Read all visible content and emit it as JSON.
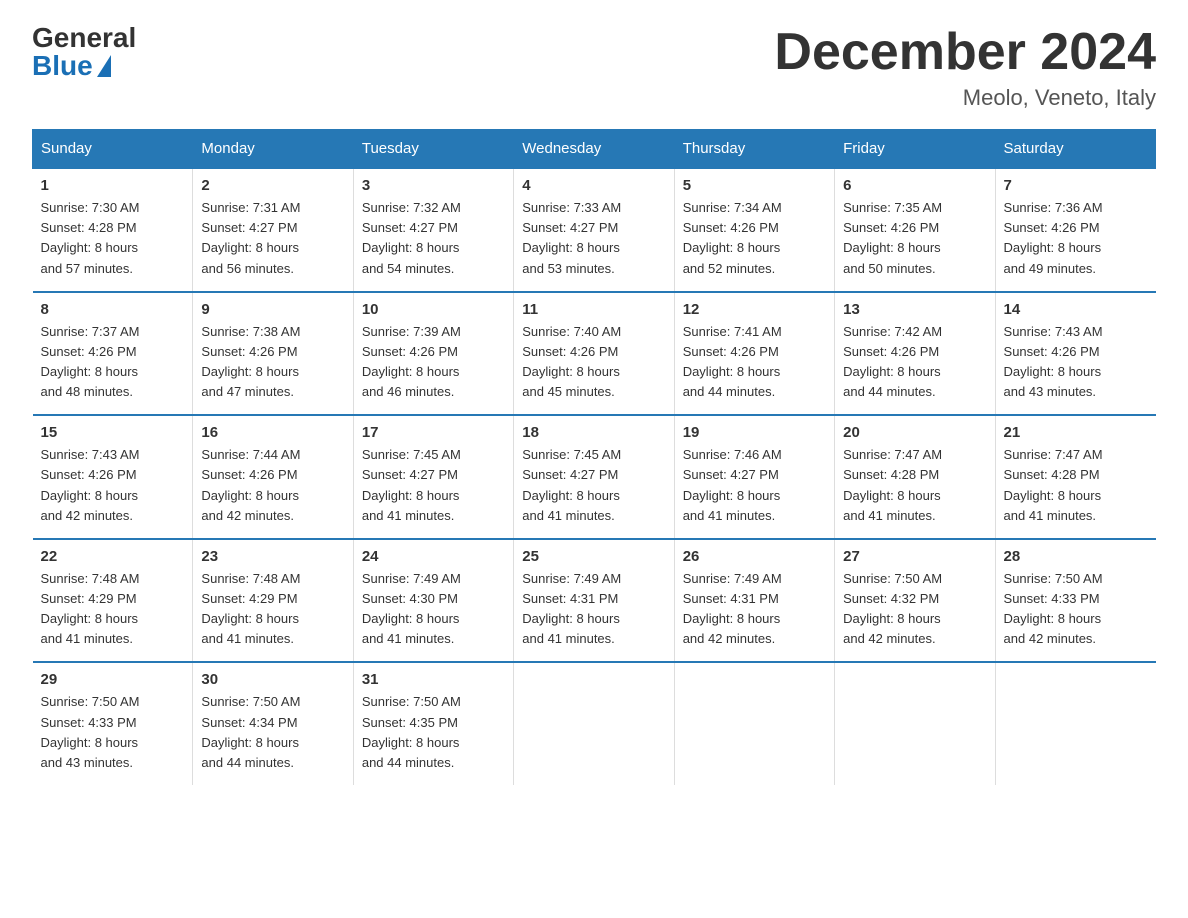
{
  "header": {
    "logo_general": "General",
    "logo_blue": "Blue",
    "month_title": "December 2024",
    "location": "Meolo, Veneto, Italy"
  },
  "weekdays": [
    "Sunday",
    "Monday",
    "Tuesday",
    "Wednesday",
    "Thursday",
    "Friday",
    "Saturday"
  ],
  "weeks": [
    [
      {
        "day": "1",
        "sunrise": "7:30 AM",
        "sunset": "4:28 PM",
        "daylight": "8 hours and 57 minutes."
      },
      {
        "day": "2",
        "sunrise": "7:31 AM",
        "sunset": "4:27 PM",
        "daylight": "8 hours and 56 minutes."
      },
      {
        "day": "3",
        "sunrise": "7:32 AM",
        "sunset": "4:27 PM",
        "daylight": "8 hours and 54 minutes."
      },
      {
        "day": "4",
        "sunrise": "7:33 AM",
        "sunset": "4:27 PM",
        "daylight": "8 hours and 53 minutes."
      },
      {
        "day": "5",
        "sunrise": "7:34 AM",
        "sunset": "4:26 PM",
        "daylight": "8 hours and 52 minutes."
      },
      {
        "day": "6",
        "sunrise": "7:35 AM",
        "sunset": "4:26 PM",
        "daylight": "8 hours and 50 minutes."
      },
      {
        "day": "7",
        "sunrise": "7:36 AM",
        "sunset": "4:26 PM",
        "daylight": "8 hours and 49 minutes."
      }
    ],
    [
      {
        "day": "8",
        "sunrise": "7:37 AM",
        "sunset": "4:26 PM",
        "daylight": "8 hours and 48 minutes."
      },
      {
        "day": "9",
        "sunrise": "7:38 AM",
        "sunset": "4:26 PM",
        "daylight": "8 hours and 47 minutes."
      },
      {
        "day": "10",
        "sunrise": "7:39 AM",
        "sunset": "4:26 PM",
        "daylight": "8 hours and 46 minutes."
      },
      {
        "day": "11",
        "sunrise": "7:40 AM",
        "sunset": "4:26 PM",
        "daylight": "8 hours and 45 minutes."
      },
      {
        "day": "12",
        "sunrise": "7:41 AM",
        "sunset": "4:26 PM",
        "daylight": "8 hours and 44 minutes."
      },
      {
        "day": "13",
        "sunrise": "7:42 AM",
        "sunset": "4:26 PM",
        "daylight": "8 hours and 44 minutes."
      },
      {
        "day": "14",
        "sunrise": "7:43 AM",
        "sunset": "4:26 PM",
        "daylight": "8 hours and 43 minutes."
      }
    ],
    [
      {
        "day": "15",
        "sunrise": "7:43 AM",
        "sunset": "4:26 PM",
        "daylight": "8 hours and 42 minutes."
      },
      {
        "day": "16",
        "sunrise": "7:44 AM",
        "sunset": "4:26 PM",
        "daylight": "8 hours and 42 minutes."
      },
      {
        "day": "17",
        "sunrise": "7:45 AM",
        "sunset": "4:27 PM",
        "daylight": "8 hours and 41 minutes."
      },
      {
        "day": "18",
        "sunrise": "7:45 AM",
        "sunset": "4:27 PM",
        "daylight": "8 hours and 41 minutes."
      },
      {
        "day": "19",
        "sunrise": "7:46 AM",
        "sunset": "4:27 PM",
        "daylight": "8 hours and 41 minutes."
      },
      {
        "day": "20",
        "sunrise": "7:47 AM",
        "sunset": "4:28 PM",
        "daylight": "8 hours and 41 minutes."
      },
      {
        "day": "21",
        "sunrise": "7:47 AM",
        "sunset": "4:28 PM",
        "daylight": "8 hours and 41 minutes."
      }
    ],
    [
      {
        "day": "22",
        "sunrise": "7:48 AM",
        "sunset": "4:29 PM",
        "daylight": "8 hours and 41 minutes."
      },
      {
        "day": "23",
        "sunrise": "7:48 AM",
        "sunset": "4:29 PM",
        "daylight": "8 hours and 41 minutes."
      },
      {
        "day": "24",
        "sunrise": "7:49 AM",
        "sunset": "4:30 PM",
        "daylight": "8 hours and 41 minutes."
      },
      {
        "day": "25",
        "sunrise": "7:49 AM",
        "sunset": "4:31 PM",
        "daylight": "8 hours and 41 minutes."
      },
      {
        "day": "26",
        "sunrise": "7:49 AM",
        "sunset": "4:31 PM",
        "daylight": "8 hours and 42 minutes."
      },
      {
        "day": "27",
        "sunrise": "7:50 AM",
        "sunset": "4:32 PM",
        "daylight": "8 hours and 42 minutes."
      },
      {
        "day": "28",
        "sunrise": "7:50 AM",
        "sunset": "4:33 PM",
        "daylight": "8 hours and 42 minutes."
      }
    ],
    [
      {
        "day": "29",
        "sunrise": "7:50 AM",
        "sunset": "4:33 PM",
        "daylight": "8 hours and 43 minutes."
      },
      {
        "day": "30",
        "sunrise": "7:50 AM",
        "sunset": "4:34 PM",
        "daylight": "8 hours and 44 minutes."
      },
      {
        "day": "31",
        "sunrise": "7:50 AM",
        "sunset": "4:35 PM",
        "daylight": "8 hours and 44 minutes."
      },
      null,
      null,
      null,
      null
    ]
  ],
  "labels": {
    "sunrise": "Sunrise:",
    "sunset": "Sunset:",
    "daylight": "Daylight:"
  }
}
